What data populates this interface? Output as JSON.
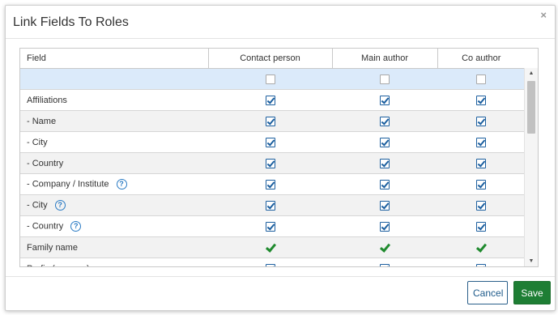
{
  "dialog": {
    "title": "Link Fields To Roles",
    "close_glyph": "×"
  },
  "table": {
    "columns": [
      "Field",
      "Contact person",
      "Main author",
      "Co author"
    ],
    "filter_row": {
      "contact": false,
      "main": false,
      "co": false
    },
    "rows": [
      {
        "label": "Affiliations",
        "help": false,
        "kind": "checkbox",
        "values": [
          true,
          true,
          true
        ]
      },
      {
        "label": "- Name",
        "help": false,
        "kind": "checkbox",
        "values": [
          true,
          true,
          true
        ]
      },
      {
        "label": "- City",
        "help": false,
        "kind": "checkbox",
        "values": [
          true,
          true,
          true
        ]
      },
      {
        "label": "- Country",
        "help": false,
        "kind": "checkbox",
        "values": [
          true,
          true,
          true
        ]
      },
      {
        "label": "- Company / Institute",
        "help": true,
        "kind": "checkbox",
        "values": [
          true,
          true,
          true
        ]
      },
      {
        "label": "- City",
        "help": true,
        "kind": "checkbox",
        "values": [
          true,
          true,
          true
        ]
      },
      {
        "label": "- Country",
        "help": true,
        "kind": "checkbox",
        "values": [
          true,
          true,
          true
        ]
      },
      {
        "label": "Family name",
        "help": false,
        "kind": "tick",
        "values": [
          true,
          true,
          true
        ]
      },
      {
        "label": "Prefix (e.g. van)",
        "help": false,
        "kind": "checkbox",
        "values": [
          true,
          true,
          true
        ]
      }
    ],
    "help_glyph": "?"
  },
  "scrollbar": {
    "up_glyph": "▲",
    "down_glyph": "▼"
  },
  "footer": {
    "cancel_label": "Cancel",
    "save_label": "Save"
  },
  "colors": {
    "filter_row_bg": "#dbeafa",
    "checkbox_accent": "#1c5f9f",
    "tick_green": "#1f8a2e",
    "save_bg": "#1e7e34",
    "cancel_text": "#1d5a8a"
  }
}
